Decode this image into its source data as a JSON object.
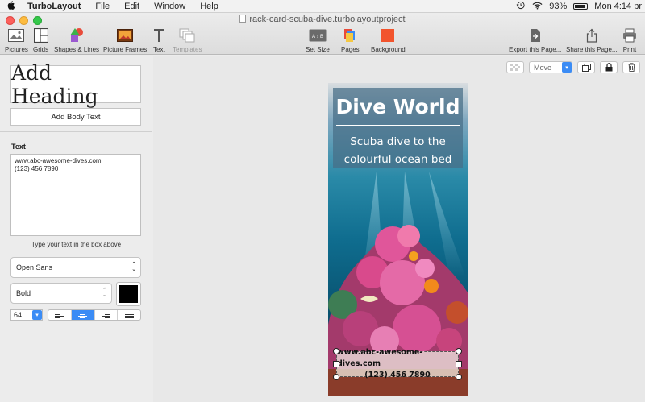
{
  "menubar": {
    "app_name": "TurboLayout",
    "menus": [
      "File",
      "Edit",
      "Window",
      "Help"
    ],
    "battery": "93%",
    "clock": "Mon 4:14 pr"
  },
  "window": {
    "document_title": "rack-card-scuba-dive.turbolayoutproject"
  },
  "toolbar": {
    "pictures": "Pictures",
    "grids": "Grids",
    "shapes": "Shapes & Lines",
    "frames": "Picture Frames",
    "text": "Text",
    "templates": "Templates",
    "set_size": "Set Size",
    "pages": "Pages",
    "background": "Background",
    "export": "Export this Page...",
    "share": "Share this Page...",
    "print": "Print",
    "set_size_icon_text": "A ↕ B"
  },
  "sidebar": {
    "add_heading": "Add Heading",
    "add_body_text": "Add Body Text",
    "text_label": "Text",
    "text_content": "www.abc-awesome-dives.com\n(123) 456 7890",
    "hint": "Type your text in the box above",
    "font_family": "Open Sans",
    "font_style": "Bold",
    "font_size": "64",
    "font_color": "#000000"
  },
  "canvas": {
    "move_mode": "Move"
  },
  "card": {
    "title": "Dive World",
    "subtitle": "Scuba dive to the\ncolourful ocean bed",
    "website": "www.abc-awesome-dives.com",
    "phone": "(123) 456 7890"
  }
}
